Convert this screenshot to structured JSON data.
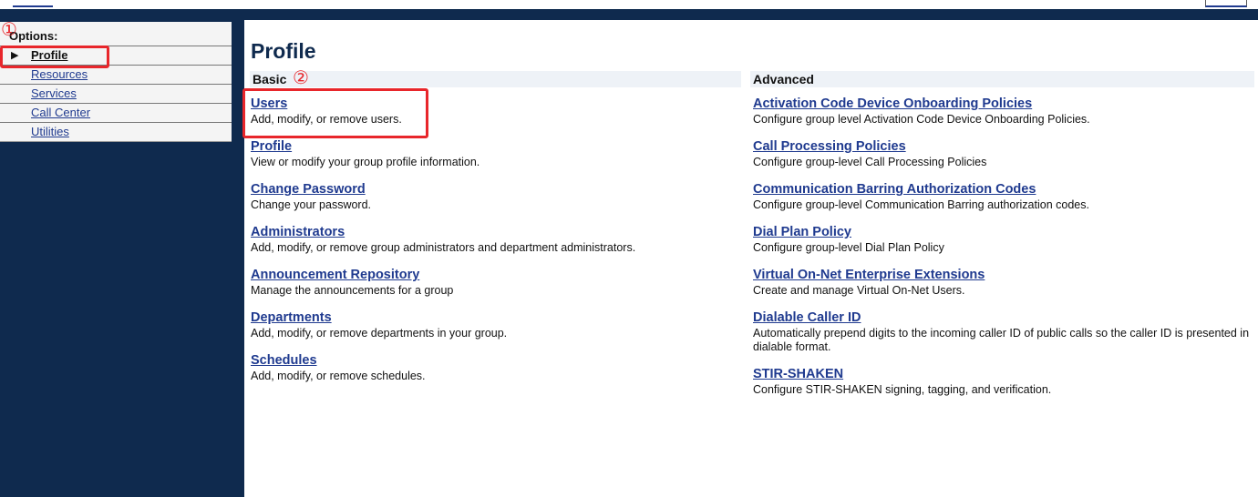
{
  "sidebar": {
    "title": "Options:",
    "items": [
      {
        "label": "Profile",
        "active": true
      },
      {
        "label": "Resources"
      },
      {
        "label": "Services"
      },
      {
        "label": "Call Center"
      },
      {
        "label": "Utilities"
      }
    ]
  },
  "annotations": {
    "one": "①",
    "two": "②",
    "color": "#e8262b"
  },
  "main": {
    "title": "Profile",
    "basic": {
      "header": "Basic",
      "items": [
        {
          "link": "Users",
          "desc": "Add, modify, or remove users."
        },
        {
          "link": "Profile",
          "desc": "View or modify your group profile information."
        },
        {
          "link": "Change Password",
          "desc": "Change your password."
        },
        {
          "link": "Administrators",
          "desc": "Add, modify, or remove group administrators and department administrators."
        },
        {
          "link": "Announcement Repository",
          "desc": "Manage the announcements for a group"
        },
        {
          "link": "Departments",
          "desc": "Add, modify, or remove departments in your group."
        },
        {
          "link": "Schedules",
          "desc": "Add, modify, or remove schedules."
        }
      ]
    },
    "advanced": {
      "header": "Advanced",
      "items": [
        {
          "link": "Activation Code Device Onboarding Policies",
          "desc": "Configure group level Activation Code Device Onboarding Policies."
        },
        {
          "link": "Call Processing Policies",
          "desc": "Configure group-level Call Processing Policies"
        },
        {
          "link": "Communication Barring Authorization Codes",
          "desc": "Configure group-level Communication Barring authorization codes."
        },
        {
          "link": "Dial Plan Policy",
          "desc": "Configure group-level Dial Plan Policy"
        },
        {
          "link": "Virtual On-Net Enterprise Extensions",
          "desc": "Create and manage Virtual On-Net Users."
        },
        {
          "link": "Dialable Caller ID",
          "desc": "Automatically prepend digits to the incoming caller ID of public calls so the caller ID is presented in dialable format."
        },
        {
          "link": "STIR-SHAKEN",
          "desc": "Configure STIR-SHAKEN signing, tagging, and verification."
        }
      ]
    }
  },
  "colors": {
    "navy": "#0f2a4e",
    "link": "#1f3a8f",
    "header_bg": "#eef2f7"
  }
}
